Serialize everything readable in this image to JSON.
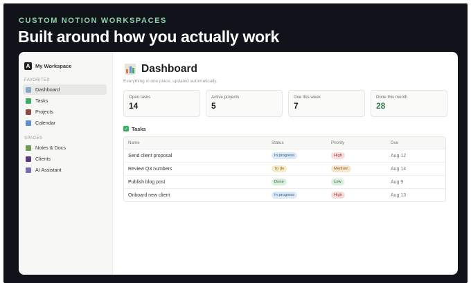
{
  "banner": {
    "eyebrow": "CUSTOM NOTION WORKSPACES",
    "headline": "Built around how you actually work"
  },
  "sidebar": {
    "workspace_name": "My Workspace",
    "workspace_initial": "A",
    "favorites_label": "FAVORITES",
    "favorites": [
      {
        "label": "Dashboard",
        "icon": "bar-chart-icon",
        "color": "#8aa7c7",
        "active": true
      },
      {
        "label": "Tasks",
        "icon": "checkbox-icon",
        "color": "#3fae65",
        "active": false
      },
      {
        "label": "Projects",
        "icon": "briefcase-icon",
        "color": "#8b4a3c",
        "active": false
      },
      {
        "label": "Calendar",
        "icon": "calendar-icon",
        "color": "#5b8fd1",
        "active": false
      }
    ],
    "spaces_label": "SPACES",
    "spaces": [
      {
        "label": "Notes & Docs",
        "icon": "books-icon",
        "color": "#6e9a5a"
      },
      {
        "label": "Clients",
        "icon": "people-icon",
        "color": "#5a3a7a"
      },
      {
        "label": "AI Assistant",
        "icon": "robot-icon",
        "color": "#7d6bb0"
      }
    ]
  },
  "page": {
    "title": "Dashboard",
    "subtitle": "Everything in one place, updated automatically."
  },
  "stats": [
    {
      "label": "Open tasks",
      "value": "14"
    },
    {
      "label": "Active projects",
      "value": "5"
    },
    {
      "label": "Due this week",
      "value": "7"
    },
    {
      "label": "Done this month",
      "value": "28"
    }
  ],
  "tasks": {
    "heading": "Tasks",
    "columns": [
      "Name",
      "Status",
      "Priority",
      "Due"
    ],
    "rows": [
      {
        "name": "Send client proposal",
        "status": "In progress",
        "priority": "High",
        "due": "Aug 12"
      },
      {
        "name": "Review Q3 numbers",
        "status": "To do",
        "priority": "Medium",
        "due": "Aug 14"
      },
      {
        "name": "Publish blog post",
        "status": "Done",
        "priority": "Low",
        "due": "Aug 9"
      },
      {
        "name": "Onboard new client",
        "status": "In progress",
        "priority": "High",
        "due": "Aug 13"
      }
    ]
  },
  "colors": {
    "accent_green": "#8fd3a8",
    "done_value": "#2f7a4f",
    "frame_bg": "#10141a"
  }
}
